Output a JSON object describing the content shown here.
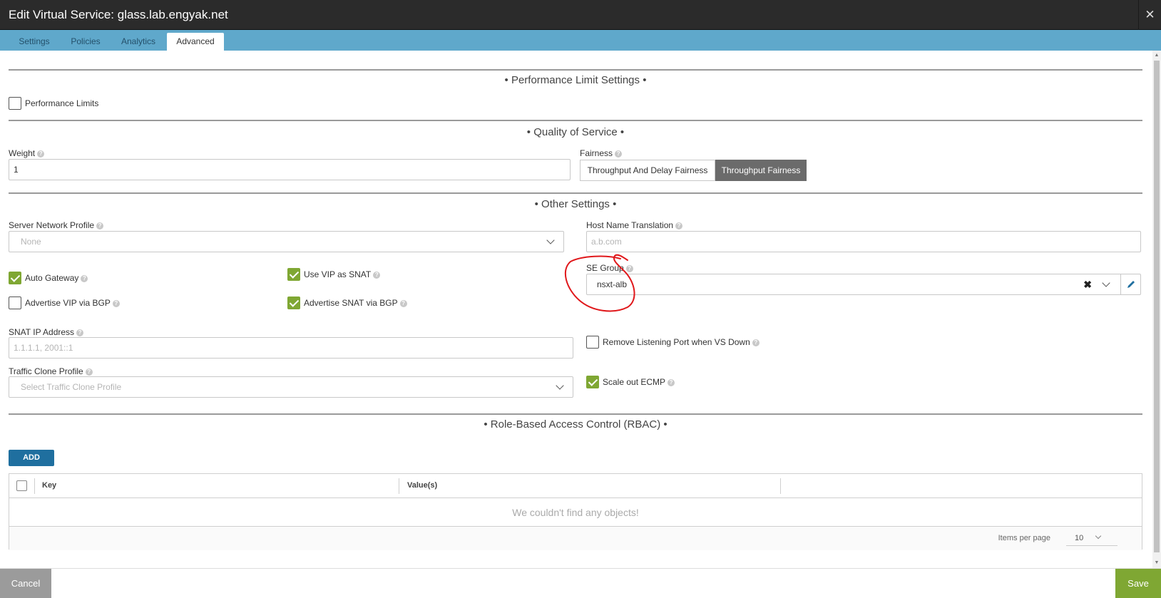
{
  "window": {
    "title": "Edit Virtual Service: glass.lab.engyak.net",
    "close_glyph": "✕"
  },
  "tabs": [
    {
      "label": "Settings",
      "active": false
    },
    {
      "label": "Policies",
      "active": false
    },
    {
      "label": "Analytics",
      "active": false
    },
    {
      "label": "Advanced",
      "active": true
    }
  ],
  "performance": {
    "section_title": "• Performance Limit Settings •",
    "limits_label": "Performance Limits",
    "limits_checked": false
  },
  "qos": {
    "section_title": "• Quality of Service •",
    "weight_label": "Weight",
    "weight_value": "1",
    "fairness_label": "Fairness",
    "fairness_options": [
      "Throughput And Delay Fairness",
      "Throughput Fairness"
    ],
    "fairness_selected": "Throughput Fairness"
  },
  "other": {
    "section_title": "• Other Settings •",
    "server_network_profile_label": "Server Network Profile",
    "server_network_profile_value": "None",
    "host_name_translation_label": "Host Name Translation",
    "host_name_translation_placeholder": "a.b.com",
    "se_group_label": "SE Group",
    "se_group_value": "nsxt-alb",
    "auto_gateway_label": "Auto Gateway",
    "auto_gateway_checked": true,
    "use_vip_as_snat_label": "Use VIP as SNAT",
    "use_vip_as_snat_checked": true,
    "advertise_vip_bgp_label": "Advertise VIP via BGP",
    "advertise_vip_bgp_checked": false,
    "advertise_snat_bgp_label": "Advertise SNAT via BGP",
    "advertise_snat_bgp_checked": true,
    "snat_ip_label": "SNAT IP Address",
    "snat_ip_placeholder": "1.1.1.1, 2001::1",
    "remove_listening_port_label": "Remove Listening Port when VS Down",
    "remove_listening_port_checked": false,
    "traffic_clone_label": "Traffic Clone Profile",
    "traffic_clone_placeholder": "Select Traffic Clone Profile",
    "scale_out_ecmp_label": "Scale out ECMP",
    "scale_out_ecmp_checked": true
  },
  "rbac": {
    "section_title": "• Role-Based Access Control (RBAC) •",
    "add_label": "ADD",
    "columns": [
      "Key",
      "Value(s)"
    ],
    "empty_text": "We couldn't find any objects!",
    "items_per_page_label": "Items per page",
    "items_per_page_value": "10"
  },
  "footer": {
    "cancel_label": "Cancel",
    "save_label": "Save"
  },
  "colors": {
    "header_bg": "#2b2b2b",
    "tabbar_bg": "#5fa8cb",
    "check_green": "#7fa733",
    "add_button_blue": "#1f6f9f",
    "annotation_red": "#e0181b"
  },
  "icons": [
    "close-icon",
    "help-icon",
    "chevron-down-icon",
    "clear-icon",
    "edit-pencil-icon",
    "checkmark-icon"
  ]
}
